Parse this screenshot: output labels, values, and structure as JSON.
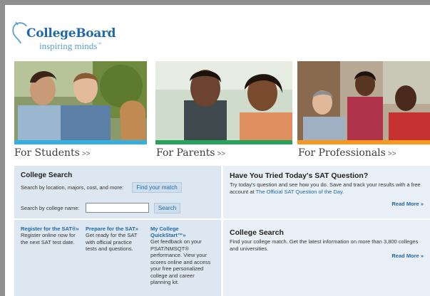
{
  "logo": {
    "name": "CollegeBoard",
    "tagline": "inspiring minds",
    "tagline_mark": "™"
  },
  "audiences": [
    {
      "label": "For Students",
      "arrow": ">>",
      "stripe_color": "#36aee0"
    },
    {
      "label": "For Parents",
      "arrow": ">>",
      "stripe_color": "#27a15b"
    },
    {
      "label": "For Professionals",
      "arrow": ">>",
      "stripe_color": "#f59a1e"
    }
  ],
  "college_search": {
    "title": "College Search",
    "description": "Search by location, majors, cost, and more:",
    "match_button": "Find your match",
    "name_label": "Search by college name:",
    "name_value": "",
    "search_button": "Search"
  },
  "links": [
    {
      "title": "Register for the SAT®»",
      "text": "Register online now for the next SAT test date."
    },
    {
      "title": "Prepare for the SAT»",
      "text": "Get ready for the SAT with official practice tests and questions."
    },
    {
      "title": "My College QuickStart™»",
      "text": "Get feedback on your PSAT/NMSQT® performance. View your scores online and access your free personalized college and career planning kit."
    }
  ],
  "sat_question": {
    "title": "Have You Tried Today's SAT Question?",
    "text_before": "Try today's question and see how you do. Save and track your results with a free account at",
    "link_text": "The Official SAT Question of the Day.",
    "read_more": "Read More »"
  },
  "college_search_promo": {
    "title": "College Search",
    "text": "Find your college match. Get the latest information on more than 3,800 colleges and universities.",
    "read_more": "Read More »"
  }
}
